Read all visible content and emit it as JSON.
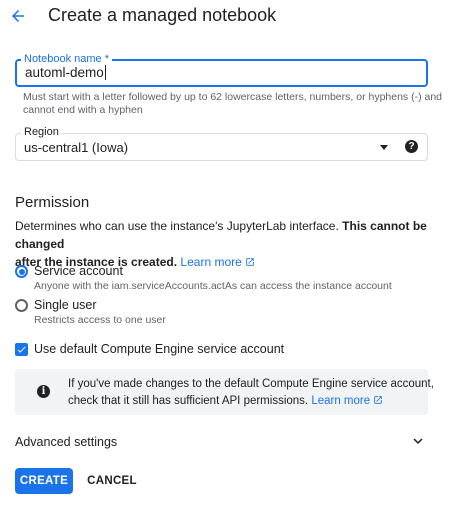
{
  "header": {
    "back_icon": "arrow-back-icon",
    "title": "Create a managed notebook"
  },
  "notebook_name": {
    "label": "Notebook name *",
    "value": "automl-demo",
    "hint_line1": "Must start with a letter followed by up to 62 lowercase letters, numbers, or hyphens (-) and",
    "hint_line2": "cannot end with a hyphen"
  },
  "region": {
    "label": "Region",
    "value": "us-central1 (Iowa)",
    "dropdown_icon": "arrow-drop-down-icon",
    "help_icon": "help-icon"
  },
  "permission": {
    "title": "Permission",
    "desc_part1": "Determines who can use the instance's JupyterLab interface.",
    "desc_bold1": "This cannot be changed",
    "desc_bold2": "after the instance is created.",
    "learn_more": "Learn more",
    "options": [
      {
        "label": "Service account",
        "sub": "Anyone with the iam.serviceAccounts.actAs can access the instance account",
        "selected": true
      },
      {
        "label": "Single user",
        "sub": "Restricts access to one user",
        "selected": false
      }
    ],
    "default_sa_checkbox": {
      "label": "Use default Compute Engine service account",
      "checked": true
    }
  },
  "info": {
    "icon": "info-icon",
    "line1": "If you've made changes to the default Compute Engine service account,",
    "line2": "check that it still has sufficient API permissions.",
    "learn_more": "Learn more"
  },
  "advanced": {
    "label": "Advanced settings",
    "icon": "expand-more-icon"
  },
  "actions": {
    "create": "CREATE",
    "cancel": "CANCEL"
  },
  "colors": {
    "accent": "#1a73e8",
    "info_bg": "#f1f3f4"
  }
}
